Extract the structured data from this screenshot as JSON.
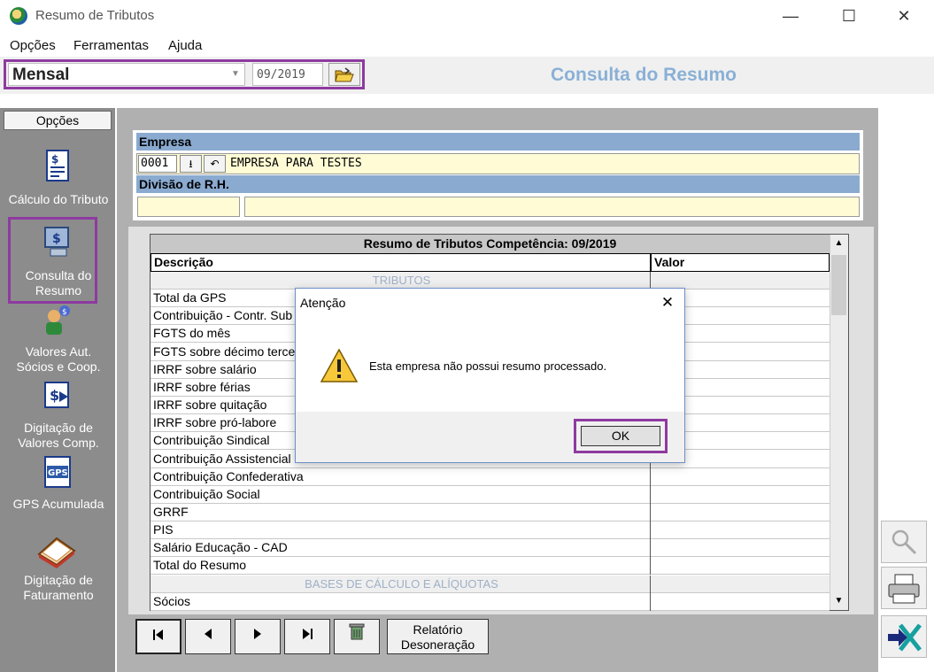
{
  "window": {
    "title": "Resumo de Tributos",
    "minimize": "—",
    "maximize": "☐",
    "close": "✕"
  },
  "menu": [
    "Opções",
    "Ferramentas",
    "Ajuda"
  ],
  "toolbar": {
    "period": "Mensal",
    "competencia": "09/2019",
    "page_title": "Consulta do Resumo"
  },
  "sidebar": {
    "tab": "Opções",
    "items": [
      {
        "label": "Cálculo do Tributo",
        "icon": "calc-tax-icon"
      },
      {
        "label": "Consulta do Resumo",
        "icon": "computer-query-icon"
      },
      {
        "label": "Valores Aut. Sócios e Coop.",
        "icon": "partners-icon"
      },
      {
        "label": "Digitação de Valores Comp.",
        "icon": "money-entry-icon"
      },
      {
        "label": "GPS Acumulada",
        "icon": "gps-icon"
      },
      {
        "label": "Digitação de Faturamento",
        "icon": "billing-icon"
      }
    ]
  },
  "empresa": {
    "header": "Empresa",
    "code": "0001",
    "name": "EMPRESA PARA TESTES",
    "division_header": "Divisão de R.H."
  },
  "grid": {
    "title": "Resumo de Tributos Competência: 09/2019",
    "col_desc": "Descrição",
    "col_value": "Valor",
    "rows": [
      {
        "desc": "TRIBUTOS",
        "section": true
      },
      {
        "desc": "Total da GPS"
      },
      {
        "desc": "Contribuição - Contr. Sub"
      },
      {
        "desc": "FGTS do mês"
      },
      {
        "desc": "FGTS sobre décimo terce"
      },
      {
        "desc": "IRRF sobre salário"
      },
      {
        "desc": "IRRF sobre férias"
      },
      {
        "desc": "IRRF sobre quitação"
      },
      {
        "desc": "IRRF sobre pró-labore"
      },
      {
        "desc": "Contribuição Sindical"
      },
      {
        "desc": "Contribuição Assistencial"
      },
      {
        "desc": "Contribuição Confederativa"
      },
      {
        "desc": "Contribuição Social"
      },
      {
        "desc": "GRRF"
      },
      {
        "desc": "PIS"
      },
      {
        "desc": "Salário Educação - CAD"
      },
      {
        "desc": "Total do Resumo"
      },
      {
        "desc": "BASES DE CÁLCULO E ALÍQUOTAS",
        "section": true
      },
      {
        "desc": "Sócios"
      }
    ]
  },
  "nav": {
    "report_label": "Relatório Desoneração"
  },
  "dialog": {
    "title": "Atenção",
    "message": "Esta empresa não possui resumo processado.",
    "ok": "OK"
  },
  "colors": {
    "accent_highlight": "#8e3aa0",
    "header_blue": "#8aaad0",
    "title_blue": "#8ab0d6",
    "yellow_field": "#fffcd5"
  }
}
